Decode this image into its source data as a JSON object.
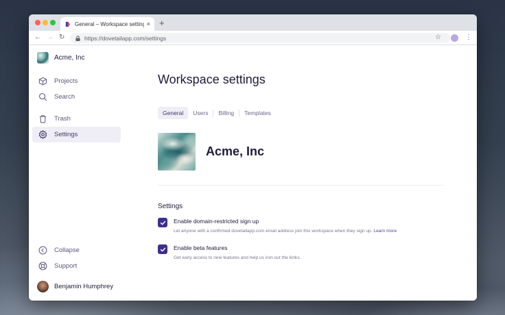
{
  "browser": {
    "tab_title": "General – Workspace settings",
    "tab_close": "×",
    "new_tab": "+",
    "url": "https://dovetailapp.com/settings"
  },
  "sidebar": {
    "workspace_name": "Acme, Inc",
    "items": [
      {
        "label": "Projects",
        "icon": "cube-icon"
      },
      {
        "label": "Search",
        "icon": "search-icon"
      },
      {
        "label": "Trash",
        "icon": "trash-icon"
      },
      {
        "label": "Settings",
        "icon": "gear-icon",
        "active": true
      }
    ],
    "bottom_items": [
      {
        "label": "Collapse",
        "icon": "chevron-left-circle-icon"
      },
      {
        "label": "Support",
        "icon": "lifebuoy-icon"
      }
    ],
    "user_name": "Benjamin Humphrey"
  },
  "main": {
    "title": "Workspace settings",
    "tabs": [
      {
        "label": "General",
        "active": true
      },
      {
        "label": "Users"
      },
      {
        "label": "Billing"
      },
      {
        "label": "Templates"
      }
    ],
    "workspace_name": "Acme, Inc",
    "section_title": "Settings",
    "settings": [
      {
        "title": "Enable domain-restricted sign up",
        "description": "Let anyone with a confirmed dovetailapp.com email address join this workspace when they sign up.",
        "link": "Learn more",
        "checked": true
      },
      {
        "title": "Enable beta features",
        "description": "Get early access to new features and help us iron out the kinks.",
        "checked": true
      }
    ]
  },
  "colors": {
    "accent": "#3d2f8f",
    "active_bg": "#efeef7",
    "text_dark": "#1e1b3a",
    "text_muted": "#5b5776"
  }
}
